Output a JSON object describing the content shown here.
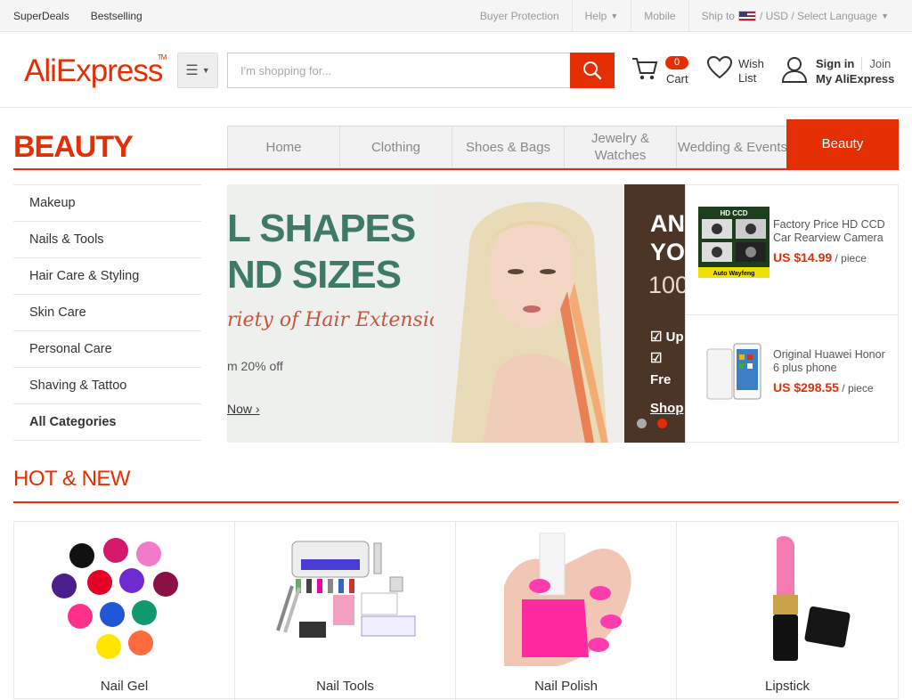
{
  "topbar": {
    "left": [
      "SuperDeals",
      "Bestselling"
    ],
    "buyer_protection": "Buyer Protection",
    "help": "Help",
    "mobile": "Mobile",
    "ship_to": "Ship to",
    "currency": "/  USD",
    "language": "/ Select Language"
  },
  "header": {
    "logo_part1": "Ali",
    "logo_part2": "Express",
    "logo_tm": "TM",
    "search_placeholder": "I'm shopping for...",
    "cart_count": "0",
    "cart_label": "Cart",
    "wish_label_1": "Wish",
    "wish_label_2": "List",
    "sign_in": "Sign in",
    "join": "Join",
    "my_account": "My AliExpress"
  },
  "category": {
    "title": "BEAUTY",
    "tabs": [
      "Home",
      "Clothing",
      "Shoes & Bags",
      "Jewelry & Watches",
      "Wedding & Events"
    ],
    "active_tab": "Beauty"
  },
  "sidemenu": [
    "Makeup",
    "Nails & Tools",
    "Hair Care & Styling",
    "Skin Care",
    "Personal Care",
    "Shaving & Tattoo",
    "All Categories"
  ],
  "banner": {
    "line1": "L SHAPES",
    "line2": "ND SIZES",
    "line3": "riety of Hair Extensions",
    "line4": "m 20% off",
    "cta": "Now ›",
    "slide2_l1": "AN",
    "slide2_l2": "YO",
    "slide2_l3": "100",
    "slide2_b1": "☑ Up",
    "slide2_b2": "☑ Fre",
    "slide2_cta": "Shop",
    "slides_total": 2,
    "active_slide": 2
  },
  "deals": [
    {
      "name": "Factory Price HD CCD Car Rearview Camera",
      "price": "US $14.99",
      "unit": " / piece",
      "img_label_top": "HD CCD",
      "img_label_bottom": "Auto Wayfeng"
    },
    {
      "name": "Original Huawei Honor 6 plus phone",
      "price": "US $298.55",
      "unit": " / piece"
    }
  ],
  "hot_new": {
    "title": "HOT & NEW",
    "products": [
      "Nail Gel",
      "Nail Tools",
      "Nail Polish",
      "Lipstick"
    ]
  },
  "colors": {
    "accent": "#e62e04",
    "logo_orange": "#f7a21b"
  }
}
